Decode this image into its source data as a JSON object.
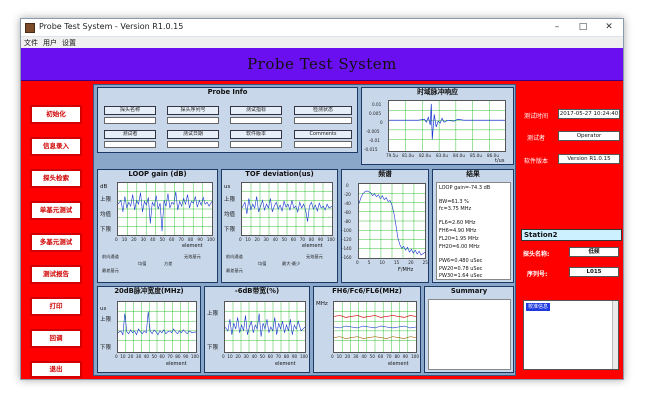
{
  "window": {
    "title": "Probe Test System - Version R1.0.15"
  },
  "menu": [
    "文件",
    "用户",
    "设置"
  ],
  "banner": {
    "title": "Probe Test System"
  },
  "left_buttons": [
    "初始化",
    "信息录入",
    "探头检索",
    "单基元测试",
    "多基元测试",
    "测试报告",
    "打印",
    "回调",
    "退出"
  ],
  "probe_info": {
    "title": "Probe Info",
    "row1": [
      "探头名称",
      "探头序列号",
      "测试指标",
      "检测状态"
    ],
    "row2": [
      "测试者",
      "测试日期",
      "软件版本",
      "Comments"
    ]
  },
  "pulse": {
    "title": "时域脉冲响应",
    "y_ticks": [
      "0.01",
      "0.005",
      "0",
      "-0.005",
      "-0.01",
      "-0.015"
    ],
    "x_ticks": [
      "79.5u",
      "81.0u",
      "82.0u",
      "83.0u",
      "84.0u",
      "85.0u",
      "86.0u"
    ],
    "x_unit": "t/us"
  },
  "loop_gain": {
    "title": "LOOP gain (dB)",
    "y_unit": "dB",
    "levels": [
      "上限",
      "均值",
      "下限"
    ],
    "x_ticks": [
      "0",
      "10",
      "20",
      "30",
      "40",
      "50",
      "60",
      "70",
      "80",
      "90",
      "100"
    ],
    "xlabel": "element",
    "foot": [
      "前向通道",
      "均值",
      "方差",
      "无效基元",
      "最差基元"
    ]
  },
  "tof": {
    "title": "TOF deviation(us)",
    "y_unit": "us",
    "levels": [
      "上限",
      "均值",
      "下限"
    ],
    "x_ticks": [
      "0",
      "10",
      "20",
      "30",
      "40",
      "50",
      "60",
      "70",
      "80",
      "90",
      "100"
    ],
    "xlabel": "element",
    "foot": [
      "前向通道",
      "均值",
      "最大-最少",
      "无效基元",
      "最差基元"
    ]
  },
  "spectrum": {
    "title": "频谱",
    "y_ticks": [
      "0",
      "-20",
      "-40",
      "-60",
      "-80",
      "-100",
      "-120",
      "-140",
      "-160"
    ],
    "x_ticks": [
      "0",
      "5",
      "10",
      "15",
      "20",
      "25"
    ],
    "x_unit": "F/MHz"
  },
  "results": {
    "title": "结果",
    "lines": [
      "LOOP gain=-74.3 dB",
      "BW=61.3 %",
      "fc=3.75 MHz",
      "FL6=2.60 MHz",
      "FH6=4.90 MHz",
      "FL20=1.95 MHz",
      "FH20=6.00 MHz",
      "PW6=0.480 uSec",
      "PW20=0.78 uSec",
      "PW30=1.64 uSec"
    ]
  },
  "bw20": {
    "title": "20dB脉冲宽度(MHz)",
    "y_unit": "us",
    "levels": [
      "上限",
      "下限"
    ],
    "x_ticks": [
      "0",
      "10",
      "20",
      "30",
      "40",
      "50",
      "60",
      "70",
      "80",
      "90",
      "100"
    ],
    "xlabel": "element"
  },
  "bw6": {
    "title": "-6dB带宽(%)",
    "levels": [
      "上限",
      "下限"
    ],
    "x_ticks": [
      "0",
      "10",
      "20",
      "30",
      "40",
      "50",
      "60",
      "70",
      "80",
      "90",
      "100"
    ],
    "xlabel": "element"
  },
  "fh": {
    "title": "FH6/Fc6/FL6(MHz)",
    "y_unit": "MHz",
    "x_ticks": [
      "0",
      "10",
      "20",
      "30",
      "40",
      "50",
      "60",
      "70",
      "80",
      "90",
      "100"
    ],
    "xlabel": "element"
  },
  "summary": {
    "title": "Summary"
  },
  "right": {
    "time_label": "测试时间",
    "time_value": "2017-05-27 10:24:40",
    "tester_label": "测试者",
    "tester_value": "Operator",
    "version_label": "软件版本",
    "version_value": "Version R1.0.15",
    "station_title": "Station2",
    "probe_name_label": "探头名称:",
    "probe_name_value": "低频",
    "serial_label": "序列号:",
    "serial_value": "L015",
    "log_first": "校准信息"
  },
  "colors": {
    "banner": "#6a0fef",
    "panel_red": "#ff0000",
    "plot_grid": "#00b000",
    "trace_blue": "#1133cc"
  }
}
